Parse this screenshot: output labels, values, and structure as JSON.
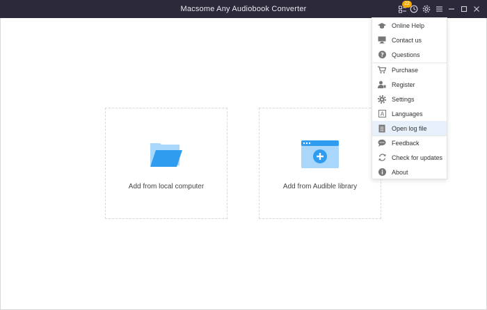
{
  "window": {
    "title": "Macsome Any Audiobook Converter",
    "badge_count": "22",
    "titlebar_color": "#2c2a3a",
    "badge_color": "#f2a900"
  },
  "toolbar_icons": [
    "tasks-icon",
    "history-icon",
    "settings-gear-icon",
    "menu-icon",
    "minimize-icon",
    "maximize-icon",
    "close-icon"
  ],
  "cards": [
    {
      "label": "Add from local computer",
      "icon": "folder-icon"
    },
    {
      "label": "Add from Audible library",
      "icon": "browser-add-icon"
    }
  ],
  "menu": {
    "items": [
      {
        "label": "Online Help",
        "icon": "graduation-cap-icon"
      },
      {
        "label": "Contact us",
        "icon": "monitor-icon"
      },
      {
        "label": "Questions",
        "icon": "question-icon"
      },
      {
        "label": "Purchase",
        "icon": "cart-icon"
      },
      {
        "label": "Register",
        "icon": "user-key-icon"
      },
      {
        "label": "Settings",
        "icon": "gear-icon"
      },
      {
        "label": "Languages",
        "icon": "language-icon"
      },
      {
        "label": "Open log file",
        "icon": "document-icon",
        "highlighted": true
      },
      {
        "label": "Feedback",
        "icon": "chat-icon"
      },
      {
        "label": "Check for updates",
        "icon": "refresh-icon"
      },
      {
        "label": "About",
        "icon": "info-icon"
      }
    ]
  },
  "accent_color": "#2f9cf0"
}
